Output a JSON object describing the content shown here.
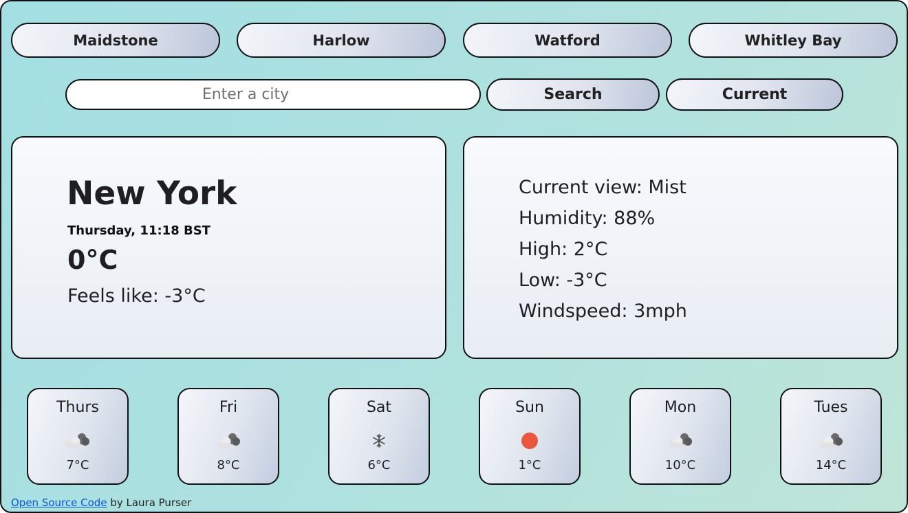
{
  "cities": [
    "Maidstone",
    "Harlow",
    "Watford",
    "Whitley Bay"
  ],
  "search": {
    "placeholder": "Enter a city",
    "search_label": "Search",
    "current_label": "Current"
  },
  "current": {
    "city": "New York",
    "datetime": "Thursday, 11:18 BST",
    "temperature": "0°C",
    "feels_like": "Feels like: -3°C"
  },
  "details": {
    "view": "Current view: Mist",
    "humidity": "Humidity: 88%",
    "high": "High: 2°C",
    "low": "Low: -3°C",
    "windspeed": "Windspeed: 3mph"
  },
  "forecast": [
    {
      "day": "Thurs",
      "icon": "cloud-icon",
      "temp": "7°C"
    },
    {
      "day": "Fri",
      "icon": "cloud-icon",
      "temp": "8°C"
    },
    {
      "day": "Sat",
      "icon": "snowflake-icon",
      "temp": "6°C"
    },
    {
      "day": "Sun",
      "icon": "sun-icon",
      "temp": "1°C"
    },
    {
      "day": "Mon",
      "icon": "cloud-icon",
      "temp": "10°C"
    },
    {
      "day": "Tues",
      "icon": "cloud-icon",
      "temp": "14°C"
    }
  ],
  "footer": {
    "link_text": "Open Source Code",
    "suffix": " by Laura Purser"
  },
  "colors": {
    "sun": "#e9573f",
    "link": "#0b57d0"
  }
}
